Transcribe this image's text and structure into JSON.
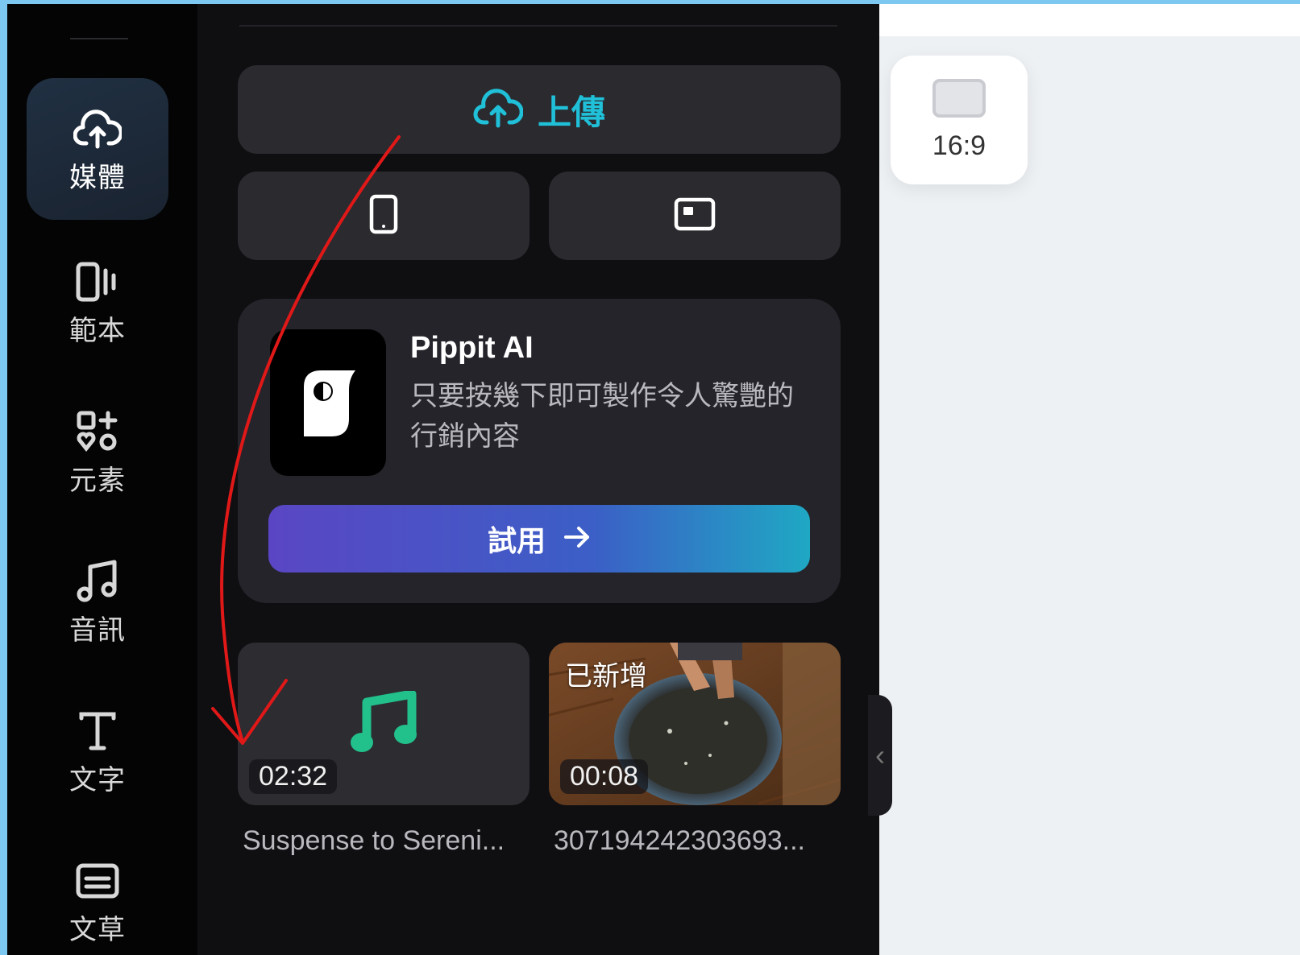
{
  "nav": {
    "items": [
      {
        "label": "媒體",
        "icon": "cloud-upload-icon",
        "active": true
      },
      {
        "label": "範本",
        "icon": "template-icon",
        "active": false
      },
      {
        "label": "元素",
        "icon": "elements-icon",
        "active": false
      },
      {
        "label": "音訊",
        "icon": "music-note-icon",
        "active": false
      },
      {
        "label": "文字",
        "icon": "text-icon",
        "active": false
      },
      {
        "label": "文草",
        "icon": "captions-icon",
        "active": false
      }
    ]
  },
  "panel": {
    "upload_label": "上傳",
    "upload_icon": "cloud-upload-icon",
    "phone_icon": "phone-icon",
    "screen_icon": "screen-record-icon",
    "ai_card": {
      "title": "Pippit AI",
      "description": "只要按幾下即可製作令人驚艷的行銷內容",
      "try_label": "試用",
      "try_icon": "arrow-right-icon"
    },
    "media": [
      {
        "name": "Suspense to Sereni...",
        "duration": "02:32",
        "type": "audio"
      },
      {
        "name": "307194242303693...",
        "duration": "00:08",
        "type": "video",
        "badge": "已新增"
      }
    ]
  },
  "canvas": {
    "ratio_label": "16:9"
  },
  "colors": {
    "accent": "#20c0d8",
    "music": "#22c08a",
    "annotation": "#e01818"
  }
}
